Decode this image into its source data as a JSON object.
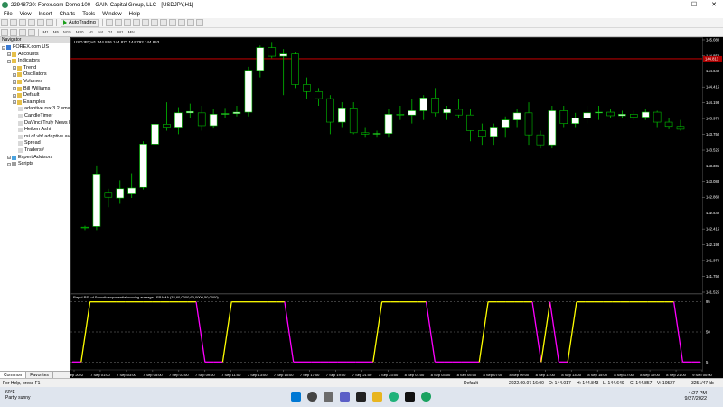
{
  "window": {
    "title": "22948720: Forex.com-Demo 100 - GAIN Capital Group, LLC - [USDJPY,H1]",
    "minimize": "–",
    "maximize": "☐",
    "close": "✕"
  },
  "menu": [
    "File",
    "View",
    "Insert",
    "Charts",
    "Tools",
    "Window",
    "Help"
  ],
  "toolbar": {
    "autotrading_label": "AutoTrading",
    "timeframes": [
      "M1",
      "M5",
      "M15",
      "M30",
      "H1",
      "H4",
      "D1",
      "W1",
      "MN"
    ]
  },
  "navigator": {
    "title": "Navigator",
    "items": [
      {
        "label": "FOREX.com US",
        "level": 0,
        "icon": "server-icon"
      },
      {
        "label": "Accounts",
        "level": 1,
        "icon": "folder-icon"
      },
      {
        "label": "Indicators",
        "level": 1,
        "icon": "folder-icon"
      },
      {
        "label": "Trend",
        "level": 2,
        "icon": "folder-icon"
      },
      {
        "label": "Oscillators",
        "level": 2,
        "icon": "folder-icon"
      },
      {
        "label": "Volumes",
        "level": 2,
        "icon": "folder-icon"
      },
      {
        "label": "Bill Williams",
        "level": 2,
        "icon": "folder-icon"
      },
      {
        "label": "Default",
        "level": 2,
        "icon": "folder-icon"
      },
      {
        "label": "Examples",
        "level": 2,
        "icon": "folder-icon"
      },
      {
        "label": "adaptive rsx 3.2 sma",
        "level": 3,
        "icon": "indicator-icon"
      },
      {
        "label": "CandleTimer",
        "level": 3,
        "icon": "indicator-icon"
      },
      {
        "label": "DaVinci Truly News b",
        "level": 3,
        "icon": "indicator-icon"
      },
      {
        "label": "Heiken Ashi",
        "level": 3,
        "icon": "indicator-icon"
      },
      {
        "label": "rsi of vhf adaptive av",
        "level": 3,
        "icon": "indicator-icon"
      },
      {
        "label": "Spread",
        "level": 3,
        "icon": "indicator-icon"
      },
      {
        "label": "Traders#",
        "level": 3,
        "icon": "indicator-icon"
      },
      {
        "label": "Expert Advisors",
        "level": 1,
        "icon": "expert-icon"
      },
      {
        "label": "Scripts",
        "level": 1,
        "icon": "script-icon"
      }
    ],
    "tabs": [
      "Common",
      "Favorites"
    ]
  },
  "chart": {
    "symbol_info": "USDJPY,H1  144.826 144.872 144.792 144.853",
    "price_labels": [
      "145.080",
      "144.853",
      "144.640",
      "144.415",
      "144.193",
      "143.970",
      "143.750",
      "143.525",
      "143.305",
      "143.083",
      "142.860",
      "142.640",
      "142.415",
      "142.193",
      "141.970",
      "141.750",
      "141.525"
    ],
    "marker_price": "144.813",
    "oscillator_label": "Rapid RSI of Smooth exponential moving average : FRAMA (32,60,0000,60,0000,50,0000)",
    "osc_levels": [
      "95",
      "50",
      "5"
    ],
    "time_labels": [
      "6 Sep 2022",
      "7 Sep 01:00",
      "7 Sep 03:00",
      "7 Sep 05:00",
      "7 Sep 07:00",
      "7 Sep 09:00",
      "7 Sep 11:00",
      "7 Sep 13:00",
      "7 Sep 15:00",
      "7 Sep 17:00",
      "7 Sep 19:00",
      "7 Sep 21:00",
      "7 Sep 23:00",
      "8 Sep 01:00",
      "8 Sep 03:00",
      "8 Sep 05:00",
      "8 Sep 07:00",
      "8 Sep 09:00",
      "8 Sep 11:00",
      "8 Sep 13:00",
      "8 Sep 15:00",
      "8 Sep 17:00",
      "8 Sep 19:00",
      "8 Sep 21:00",
      "9 Sep 00:00"
    ],
    "colors": {
      "up": "#ffffff",
      "down": "#000000",
      "wick": "#00c000",
      "line": "#b00000",
      "osc_up": "#ffff00",
      "osc_down": "#ff00ff"
    }
  },
  "chart_data": {
    "type": "candlestick",
    "series": [
      {
        "o": 142.44,
        "h": 142.46,
        "l": 142.4,
        "c": 142.43
      },
      {
        "o": 142.45,
        "h": 143.31,
        "l": 142.4,
        "c": 143.19
      },
      {
        "o": 142.93,
        "h": 142.98,
        "l": 142.72,
        "c": 142.86
      },
      {
        "o": 142.85,
        "h": 143.1,
        "l": 142.78,
        "c": 142.98
      },
      {
        "o": 142.92,
        "h": 143.2,
        "l": 142.85,
        "c": 142.99
      },
      {
        "o": 143.0,
        "h": 143.65,
        "l": 142.97,
        "c": 143.61
      },
      {
        "o": 143.61,
        "h": 143.95,
        "l": 143.55,
        "c": 143.89
      },
      {
        "o": 143.89,
        "h": 144.2,
        "l": 143.8,
        "c": 143.85
      },
      {
        "o": 143.85,
        "h": 144.13,
        "l": 143.75,
        "c": 144.05
      },
      {
        "o": 144.05,
        "h": 144.18,
        "l": 143.98,
        "c": 144.07
      },
      {
        "o": 144.05,
        "h": 144.15,
        "l": 143.8,
        "c": 143.87
      },
      {
        "o": 143.87,
        "h": 144.1,
        "l": 143.83,
        "c": 144.03
      },
      {
        "o": 144.03,
        "h": 144.12,
        "l": 143.98,
        "c": 144.04
      },
      {
        "o": 144.04,
        "h": 144.15,
        "l": 144.0,
        "c": 144.06
      },
      {
        "o": 144.06,
        "h": 144.7,
        "l": 144.0,
        "c": 144.65
      },
      {
        "o": 144.65,
        "h": 145.0,
        "l": 144.55,
        "c": 144.97
      },
      {
        "o": 144.97,
        "h": 145.05,
        "l": 144.82,
        "c": 144.85
      },
      {
        "o": 144.85,
        "h": 144.95,
        "l": 144.3,
        "c": 144.88
      },
      {
        "o": 144.88,
        "h": 144.9,
        "l": 144.4,
        "c": 144.45
      },
      {
        "o": 144.45,
        "h": 144.55,
        "l": 144.25,
        "c": 144.35
      },
      {
        "o": 144.35,
        "h": 144.4,
        "l": 144.15,
        "c": 144.25
      },
      {
        "o": 144.25,
        "h": 144.3,
        "l": 143.75,
        "c": 143.92
      },
      {
        "o": 143.92,
        "h": 144.2,
        "l": 143.85,
        "c": 144.12
      },
      {
        "o": 144.12,
        "h": 144.2,
        "l": 143.75,
        "c": 143.77
      },
      {
        "o": 143.77,
        "h": 143.85,
        "l": 143.7,
        "c": 143.75
      },
      {
        "o": 143.75,
        "h": 143.8,
        "l": 143.7,
        "c": 143.76
      },
      {
        "o": 143.76,
        "h": 144.1,
        "l": 143.7,
        "c": 144.03
      },
      {
        "o": 144.03,
        "h": 144.15,
        "l": 143.95,
        "c": 144.02
      },
      {
        "o": 144.02,
        "h": 144.25,
        "l": 143.9,
        "c": 144.08
      },
      {
        "o": 144.08,
        "h": 144.3,
        "l": 143.95,
        "c": 144.26
      },
      {
        "o": 144.26,
        "h": 144.4,
        "l": 144.0,
        "c": 144.05
      },
      {
        "o": 144.05,
        "h": 144.15,
        "l": 143.95,
        "c": 144.1
      },
      {
        "o": 144.1,
        "h": 144.25,
        "l": 143.98,
        "c": 144.02
      },
      {
        "o": 144.02,
        "h": 144.1,
        "l": 143.65,
        "c": 143.8
      },
      {
        "o": 143.8,
        "h": 143.9,
        "l": 143.6,
        "c": 143.72
      },
      {
        "o": 143.72,
        "h": 143.9,
        "l": 143.6,
        "c": 143.85
      },
      {
        "o": 143.85,
        "h": 144.0,
        "l": 143.7,
        "c": 143.95
      },
      {
        "o": 143.95,
        "h": 144.1,
        "l": 143.85,
        "c": 144.05
      },
      {
        "o": 144.05,
        "h": 144.2,
        "l": 143.6,
        "c": 143.74
      },
      {
        "o": 143.74,
        "h": 143.8,
        "l": 143.55,
        "c": 143.6
      },
      {
        "o": 143.6,
        "h": 144.15,
        "l": 143.55,
        "c": 144.08
      },
      {
        "o": 144.08,
        "h": 144.15,
        "l": 143.85,
        "c": 143.9
      },
      {
        "o": 143.9,
        "h": 144.05,
        "l": 143.85,
        "c": 143.98
      },
      {
        "o": 143.98,
        "h": 144.15,
        "l": 143.9,
        "c": 144.05
      },
      {
        "o": 144.05,
        "h": 144.15,
        "l": 143.95,
        "c": 144.06
      },
      {
        "o": 144.06,
        "h": 144.1,
        "l": 143.98,
        "c": 144.01
      },
      {
        "o": 144.01,
        "h": 144.08,
        "l": 143.98,
        "c": 144.03
      },
      {
        "o": 144.03,
        "h": 144.08,
        "l": 143.95,
        "c": 143.99
      },
      {
        "o": 143.99,
        "h": 144.1,
        "l": 143.95,
        "c": 144.06
      },
      {
        "o": 144.06,
        "h": 144.08,
        "l": 143.85,
        "c": 143.92
      },
      {
        "o": 143.92,
        "h": 143.98,
        "l": 143.82,
        "c": 143.86
      },
      {
        "o": 143.86,
        "h": 143.95,
        "l": 143.8,
        "c": 143.82
      }
    ],
    "oscillator": [
      5,
      5,
      95,
      95,
      95,
      95,
      95,
      95,
      95,
      95,
      95,
      95,
      95,
      95,
      95,
      5,
      5,
      5,
      95,
      95,
      95,
      95,
      95,
      95,
      95,
      5,
      5,
      5,
      5,
      5,
      5,
      5,
      5,
      5,
      5,
      95,
      95,
      95,
      95,
      95,
      95,
      5,
      5,
      5,
      5,
      5,
      5,
      95,
      95,
      95,
      95,
      95,
      95,
      5,
      95,
      5,
      5,
      95,
      95,
      95,
      95,
      95,
      95,
      95,
      95,
      95,
      95,
      95,
      95,
      5,
      5,
      5
    ],
    "ylim": [
      141.525,
      145.08
    ],
    "osc_ylim": [
      0,
      100
    ]
  },
  "status": {
    "help": "For Help, press F1",
    "profile": "Default",
    "datetime": "2022.09.07 16:00",
    "o": "O: 144.017",
    "h": "H: 144.843",
    "l": "L: 144.649",
    "c": "C: 144.857",
    "v": "V: 10527",
    "traffic": "3251/47 kb"
  },
  "taskbar": {
    "temp": "60°F",
    "weather": "Partly sunny",
    "time": "4:27 PM",
    "date": "9/27/2022"
  }
}
